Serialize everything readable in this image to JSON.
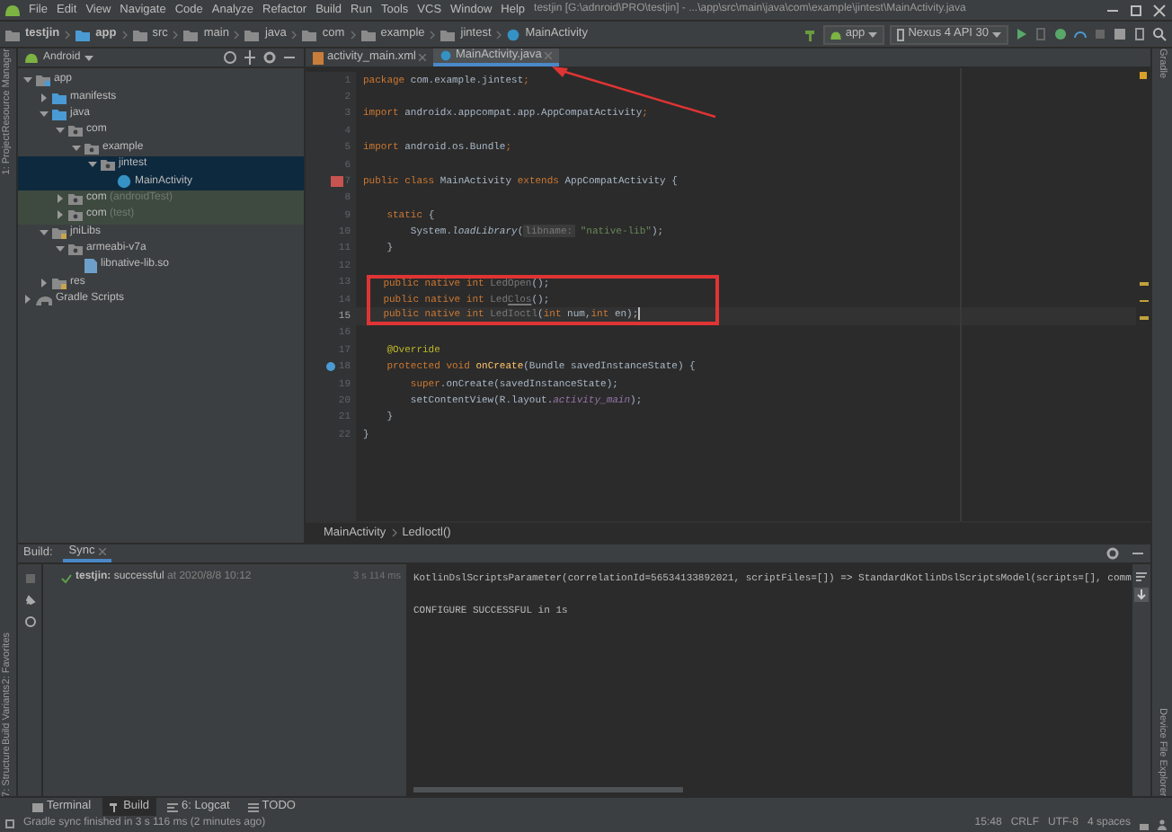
{
  "menu": [
    "File",
    "Edit",
    "View",
    "Navigate",
    "Code",
    "Analyze",
    "Refactor",
    "Build",
    "Run",
    "Tools",
    "VCS",
    "Window",
    "Help"
  ],
  "window": {
    "title": "testjin [G:\\adnroid\\PRO\\testjin] - ...\\app\\src\\main\\java\\com\\example\\jintest\\MainActivity.java"
  },
  "breadcrumbs": [
    {
      "label": "testjin",
      "kind": "project"
    },
    {
      "label": "app",
      "kind": "module"
    },
    {
      "label": "src",
      "kind": "folder"
    },
    {
      "label": "main",
      "kind": "folder"
    },
    {
      "label": "java",
      "kind": "folder"
    },
    {
      "label": "com",
      "kind": "folder"
    },
    {
      "label": "example",
      "kind": "folder"
    },
    {
      "label": "jintest",
      "kind": "folder"
    },
    {
      "label": "MainActivity",
      "kind": "class"
    }
  ],
  "run_config": "app",
  "device": "Nexus 4 API 30",
  "left_tools_top": [
    "Resource Manager",
    "1: Project"
  ],
  "left_tools_bottom": [
    "2: Favorites",
    "Build Variants",
    "7: Structure"
  ],
  "right_tools_top": [
    "Gradle"
  ],
  "right_tools_bottom": [
    "Device File Explorer"
  ],
  "project": {
    "view": "Android",
    "tree": [
      {
        "label": "app",
        "kind": "module",
        "expanded": true,
        "selected": false,
        "children": [
          {
            "label": "manifests",
            "kind": "folder",
            "expanded": false,
            "selected": false
          },
          {
            "label": "java",
            "kind": "folder",
            "expanded": true,
            "selected": false,
            "children": [
              {
                "label": "com",
                "kind": "package",
                "expanded": true,
                "selected": false,
                "children": [
                  {
                    "label": "example",
                    "kind": "package",
                    "expanded": true,
                    "selected": false,
                    "children": [
                      {
                        "label": "jintest",
                        "kind": "package",
                        "expanded": true,
                        "selected": true,
                        "children": [
                          {
                            "label": "MainActivity",
                            "kind": "class",
                            "selected": true
                          }
                        ]
                      }
                    ]
                  }
                ]
              },
              {
                "label": "com",
                "suffix": "(androidTest)",
                "test_source": true,
                "kind": "package",
                "expanded": false,
                "selected": false
              },
              {
                "label": "com",
                "suffix": "(test)",
                "test_source": true,
                "kind": "package",
                "expanded": false,
                "selected": false
              }
            ]
          },
          {
            "label": "jniLibs",
            "kind": "resfolder",
            "expanded": true,
            "selected": false,
            "children": [
              {
                "label": "armeabi-v7a",
                "kind": "package",
                "expanded": true,
                "selected": false,
                "children": [
                  {
                    "label": "libnative-lib.so",
                    "kind": "file",
                    "selected": false
                  }
                ]
              }
            ]
          },
          {
            "label": "res",
            "kind": "resfolder",
            "expanded": false,
            "selected": false
          }
        ]
      },
      {
        "label": "Gradle Scripts",
        "kind": "gradle",
        "expanded": false,
        "selected": false
      }
    ]
  },
  "editor": {
    "tabs": [
      {
        "label": "activity_main.xml",
        "kind": "xml",
        "selected": false
      },
      {
        "label": "MainActivity.java",
        "kind": "java",
        "selected": true
      }
    ],
    "lines": [
      {
        "n": "1",
        "current": false,
        "boxed": false,
        "tokens": [
          {
            "text": "package ",
            "kind": "keyword"
          },
          {
            "text": "com.example.jintest",
            "kind": "plain"
          },
          {
            "text": ";",
            "kind": "keyword"
          }
        ]
      },
      {
        "n": "2",
        "current": false,
        "boxed": false
      },
      {
        "n": "3",
        "current": false,
        "boxed": false,
        "tokens": [
          {
            "text": "import ",
            "kind": "keyword"
          },
          {
            "text": "androidx.appcompat.app.AppCompatActivity",
            "kind": "plain"
          },
          {
            "text": ";",
            "kind": "keyword"
          }
        ]
      },
      {
        "n": "4",
        "current": false,
        "boxed": false
      },
      {
        "n": "5",
        "current": false,
        "boxed": false,
        "tokens": [
          {
            "text": "import ",
            "kind": "keyword"
          },
          {
            "text": "android.os.Bundle",
            "kind": "plain"
          },
          {
            "text": ";",
            "kind": "keyword"
          }
        ]
      },
      {
        "n": "6",
        "current": false,
        "boxed": false
      },
      {
        "n": "7",
        "current": false,
        "boxed": false,
        "gutter": {
          "kind": "class"
        },
        "tokens": [
          {
            "text": "public class ",
            "kind": "keyword"
          },
          {
            "text": "MainActivity ",
            "kind": "plain"
          },
          {
            "text": "extends ",
            "kind": "keyword"
          },
          {
            "text": "AppCompatActivity {",
            "kind": "plain"
          }
        ]
      },
      {
        "n": "8",
        "current": false,
        "boxed": false
      },
      {
        "n": "9",
        "current": false,
        "boxed": false,
        "tokens": [
          {
            "text": "    static ",
            "kind": "keyword"
          },
          {
            "text": "{",
            "kind": "plain"
          }
        ]
      },
      {
        "n": "10",
        "current": false,
        "boxed": false,
        "tokens": [
          {
            "text": "        System.",
            "kind": "plain"
          },
          {
            "text": "loadLibrary",
            "kind": "italic"
          },
          {
            "text": "(",
            "kind": "plain"
          },
          {
            "text": "libname:",
            "kind": "hint"
          },
          {
            "text": " \"native-lib\"",
            "kind": "string"
          },
          {
            "text": ");",
            "kind": "plain"
          }
        ]
      },
      {
        "n": "11",
        "current": false,
        "boxed": false,
        "tokens": [
          {
            "text": "    }",
            "kind": "plain"
          }
        ]
      },
      {
        "n": "12",
        "current": false,
        "boxed": false
      },
      {
        "n": "13",
        "current": false,
        "boxed": true,
        "tokens": [
          {
            "text": "    public native int ",
            "kind": "keyword"
          },
          {
            "text": "LedOpen",
            "kind": "unused"
          },
          {
            "text": "();",
            "kind": "plain"
          }
        ]
      },
      {
        "n": "14",
        "current": false,
        "boxed": true,
        "tokens": [
          {
            "text": "    public native int ",
            "kind": "keyword"
          },
          {
            "text": "Led",
            "kind": "unused"
          },
          {
            "text": "Clos",
            "kind": "typo"
          },
          {
            "text": "();",
            "kind": "plain"
          }
        ]
      },
      {
        "n": "15",
        "current": true,
        "boxed": true,
        "tokens": [
          {
            "text": "    public native int ",
            "kind": "keyword"
          },
          {
            "text": "LedIoctl",
            "kind": "unused"
          },
          {
            "text": "(",
            "kind": "plain"
          },
          {
            "text": "int ",
            "kind": "keyword"
          },
          {
            "text": "num,",
            "kind": "plain"
          },
          {
            "text": "int ",
            "kind": "keyword"
          },
          {
            "text": "en);",
            "kind": "plain"
          }
        ]
      },
      {
        "n": "16",
        "current": false,
        "boxed": false
      },
      {
        "n": "17",
        "current": false,
        "boxed": false,
        "tokens": [
          {
            "text": "    @Override",
            "kind": "annotation"
          }
        ]
      },
      {
        "n": "18",
        "current": false,
        "boxed": false,
        "gutter": {
          "kind": "override"
        },
        "tokens": [
          {
            "text": "    protected void ",
            "kind": "keyword"
          },
          {
            "text": "onCreate",
            "kind": "declaration"
          },
          {
            "text": "(Bundle savedInstanceState) {",
            "kind": "plain"
          }
        ]
      },
      {
        "n": "19",
        "current": false,
        "boxed": false,
        "tokens": [
          {
            "text": "        super",
            "kind": "keyword"
          },
          {
            "text": ".onCreate(savedInstanceState);",
            "kind": "plain"
          }
        ]
      },
      {
        "n": "20",
        "current": false,
        "boxed": false,
        "tokens": [
          {
            "text": "        setContentView(R.layout.",
            "kind": "plain"
          },
          {
            "text": "activity_main",
            "kind": "field"
          },
          {
            "text": ");",
            "kind": "plain"
          }
        ]
      },
      {
        "n": "21",
        "current": false,
        "boxed": false,
        "tokens": [
          {
            "text": "    }",
            "kind": "plain"
          }
        ]
      },
      {
        "n": "22",
        "current": false,
        "boxed": false,
        "tokens": [
          {
            "text": "}",
            "kind": "plain"
          }
        ]
      }
    ],
    "breadcrumb": [
      "MainActivity",
      "LedIoctl()"
    ]
  },
  "build": {
    "label": "Build:",
    "tabs": [
      {
        "label": "Sync",
        "selected": true
      }
    ],
    "result": {
      "name": "testjin:",
      "status": "successful",
      "time": "at 2020/8/8 10:12",
      "duration": "3 s 114 ms"
    },
    "console": [
      "KotlinDslScriptsParameter(correlationId=56534133892021, scriptFiles=[]) => StandardKotlinDslScriptsModel(scripts=[], comm",
      "CONFIGURE SUCCESSFUL in 1s"
    ]
  },
  "bottom_tabs": [
    {
      "label": "Terminal",
      "kind": "terminal",
      "selected": false
    },
    {
      "label": "Build",
      "kind": "build",
      "selected": true
    },
    {
      "label": "6: Logcat",
      "kind": "logcat",
      "selected": false
    },
    {
      "label": "TODO",
      "kind": "todo",
      "selected": false
    }
  ],
  "status_bar": {
    "message": "Gradle sync finished in 3 s 116 ms (2 minutes ago)",
    "items": [
      "15:48",
      "CRLF",
      "UTF-8",
      "4 spaces"
    ]
  }
}
